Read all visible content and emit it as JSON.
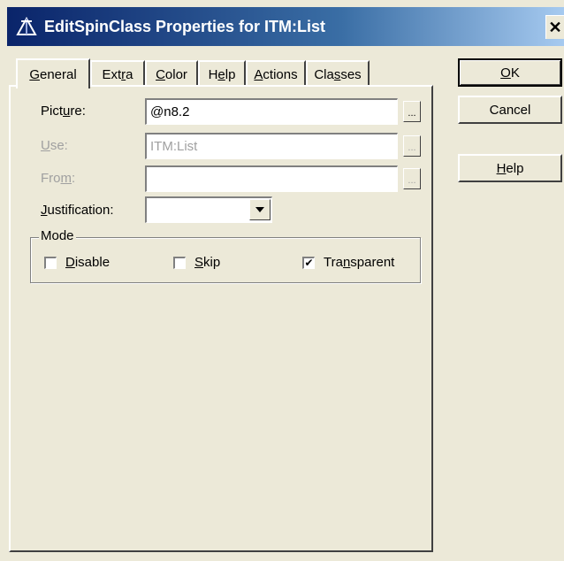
{
  "window": {
    "title": "EditSpinClass Properties for ITM:List"
  },
  "tabs": [
    {
      "label": "General",
      "active": true
    },
    {
      "label": "Extra"
    },
    {
      "label": "Color"
    },
    {
      "label": "Help"
    },
    {
      "label": "Actions"
    },
    {
      "label": "Classes"
    }
  ],
  "form": {
    "picture": {
      "label": "Picture:",
      "value": "@n8.2"
    },
    "use": {
      "label": "Use:",
      "value": "ITM:List"
    },
    "from": {
      "label": "From:",
      "value": ""
    },
    "justification": {
      "label": "Justification:",
      "value": ""
    },
    "browse_label": "..."
  },
  "mode": {
    "label": "Mode",
    "disable": {
      "label": "Disable",
      "checked": false
    },
    "skip": {
      "label": "Skip",
      "checked": false
    },
    "transparent": {
      "label": "Transparent",
      "checked": true
    }
  },
  "buttons": {
    "ok": "OK",
    "cancel": "Cancel",
    "help": "Help"
  }
}
